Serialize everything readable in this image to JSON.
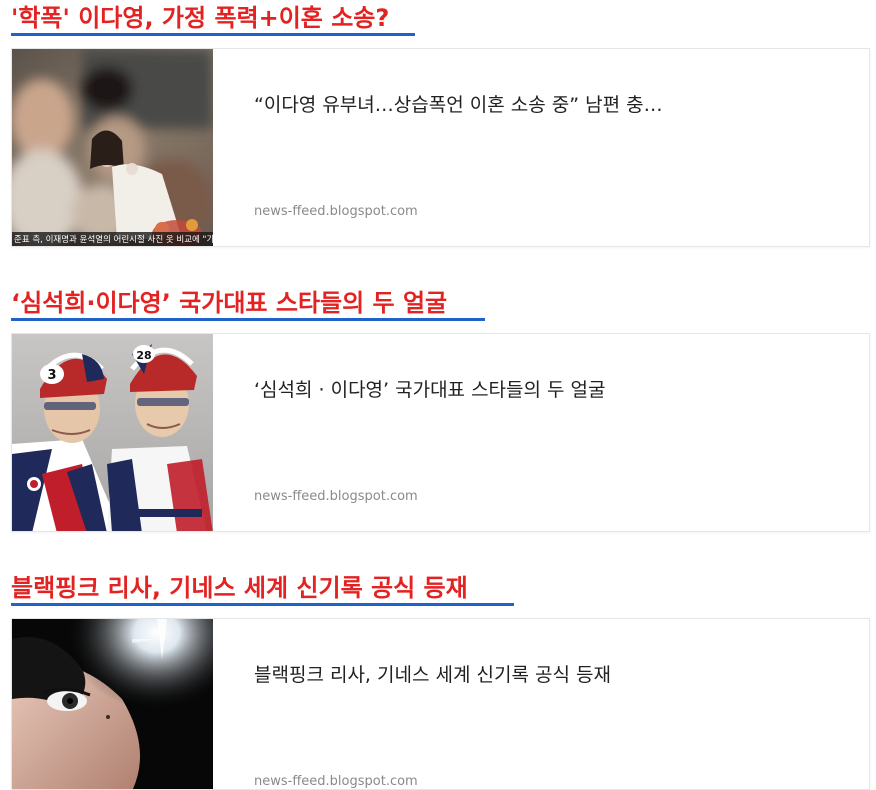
{
  "articles": [
    {
      "headline": "'학폭' 이다영, 가정 폭력+이혼 소송?",
      "card_title": "“이다영 유부녀…상습폭언 이혼 소송 중” 남편 충…",
      "source": "news-ffeed.blogspot.com",
      "thumb_caption": "준표 측, 이재명과 윤석열의 어린시절 사진 옷 비교에 \"가난이 스펙\""
    },
    {
      "headline": "‘심석희·이다영’ 국가대표 스타들의 두 얼굴",
      "card_title": "‘심석희 · 이다영’ 국가대표 스타들의 두 얼굴",
      "source": "news-ffeed.blogspot.com",
      "helmet_numbers": [
        "3",
        "28"
      ]
    },
    {
      "headline": "블랙핑크 리사, 기네스 세계 신기록 공식 등재",
      "card_title": "블랙핑크 리사, 기네스 세계 신기록 공식 등재",
      "source": "news-ffeed.blogspot.com"
    }
  ]
}
